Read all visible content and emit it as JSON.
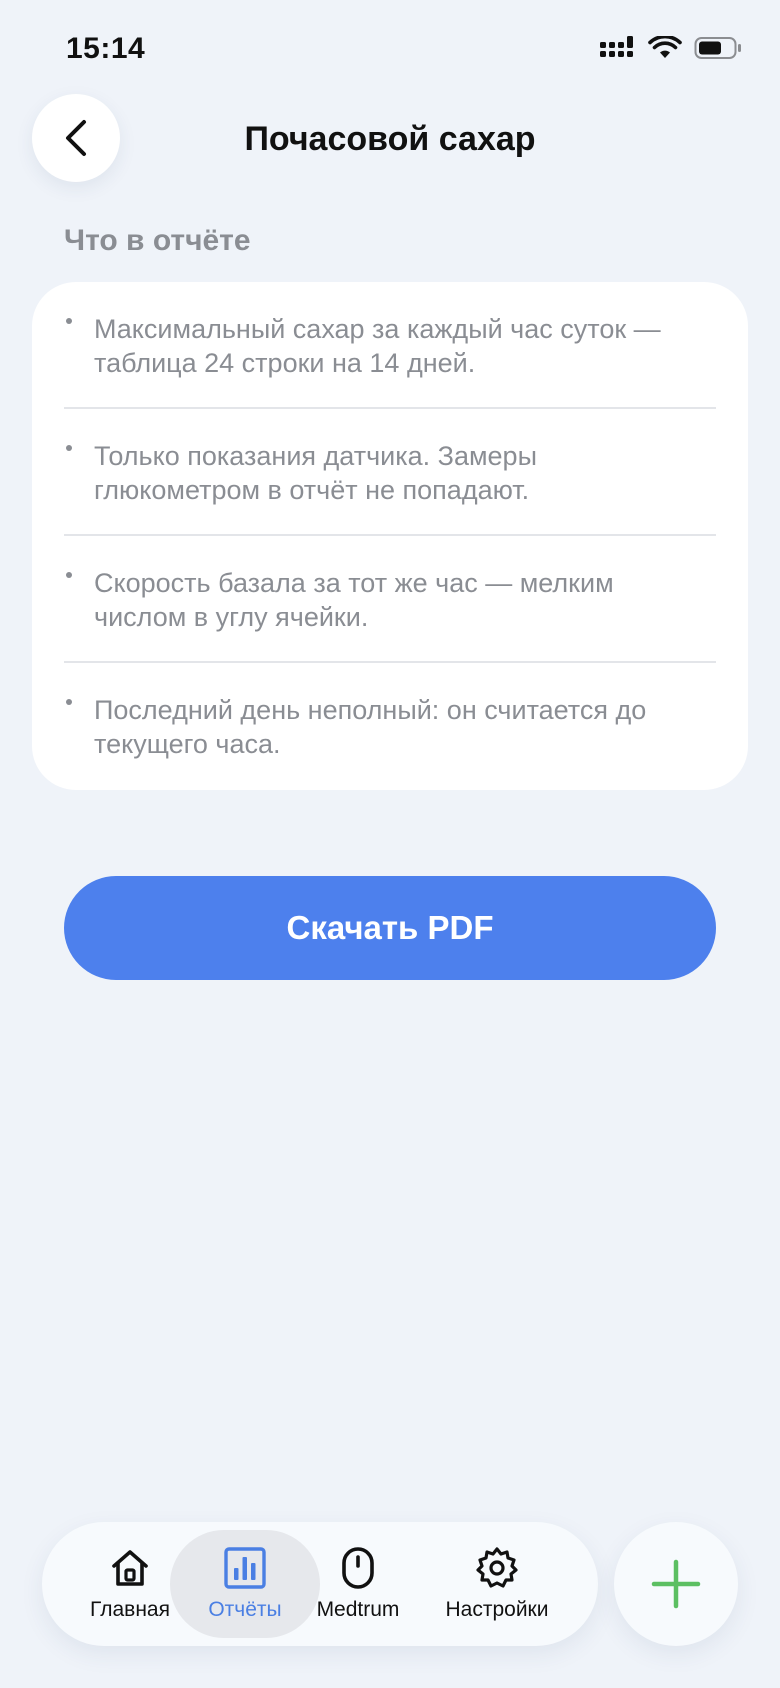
{
  "status_bar": {
    "time": "15:14"
  },
  "header": {
    "title": "Почасовой сахар",
    "back_icon": "chevron-left-icon"
  },
  "section": {
    "label": "Что в отчёте",
    "items": [
      "Максимальный сахар за каждый час суток — таблица 24 строки на 14 дней.",
      "Только показания датчика. Замеры глюкометром в отчёт не попадают.",
      "Скорость базала за тот же час — мелким числом в углу ячейки.",
      "Последний день неполный: он считается до текущего часа."
    ]
  },
  "actions": {
    "download_label": "Скачать PDF"
  },
  "nav": {
    "tabs": [
      {
        "label": "Главная",
        "icon": "home-icon"
      },
      {
        "label": "Отчёты",
        "icon": "bar-chart-icon",
        "active": true
      },
      {
        "label": "Medtrum",
        "icon": "device-icon"
      },
      {
        "label": "Настройки",
        "icon": "gear-icon"
      }
    ],
    "add_icon": "plus-icon"
  },
  "colors": {
    "background": "#eff3f9",
    "accent": "#4d80ed",
    "active_tab": "#4a7fe3",
    "add_green": "#5cbf62",
    "muted_text": "#8a8d93"
  }
}
